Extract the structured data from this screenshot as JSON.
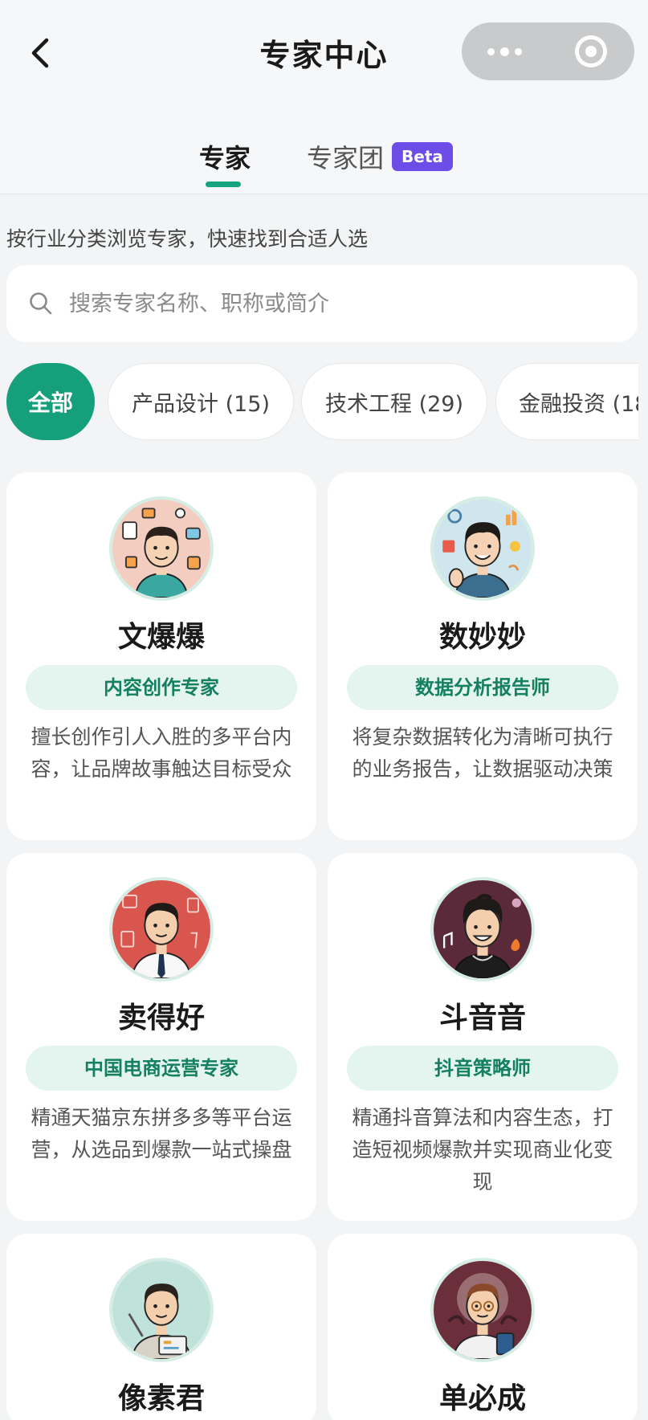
{
  "nav": {
    "title": "专家中心"
  },
  "tabs": {
    "expert": "专家",
    "team": "专家团",
    "beta": "Beta"
  },
  "subtitle": "按行业分类浏览专家，快速找到合适人选",
  "search": {
    "placeholder": "搜索专家名称、职称或简介"
  },
  "categories": [
    {
      "label": "全部",
      "selected": true
    },
    {
      "label": "产品设计 (15)"
    },
    {
      "label": "技术工程 (29)"
    },
    {
      "label": "金融投资 (18"
    }
  ],
  "experts": [
    {
      "name": "文爆爆",
      "title": "内容创作专家",
      "desc": "擅长创作引人入胜的多平台内容，让品牌故事触达目标受众"
    },
    {
      "name": "数妙妙",
      "title": "数据分析报告师",
      "desc": "将复杂数据转化为清晰可执行的业务报告，让数据驱动决策"
    },
    {
      "name": "卖得好",
      "title": "中国电商运营专家",
      "desc": "精通天猫京东拼多多等平台运营，从选品到爆款一站式操盘"
    },
    {
      "name": "斗音音",
      "title": "抖音策略师",
      "desc": "精通抖音算法和内容生态，打造短视频爆款并实现商业化变现"
    },
    {
      "name": "像素君",
      "title": "",
      "desc": ""
    },
    {
      "name": "单必成",
      "title": "",
      "desc": ""
    }
  ],
  "colors": {
    "accent": "#16a37f",
    "beta": "#6d4ce8",
    "tag_bg": "#e4f4ee",
    "tag_text": "#14805f"
  }
}
